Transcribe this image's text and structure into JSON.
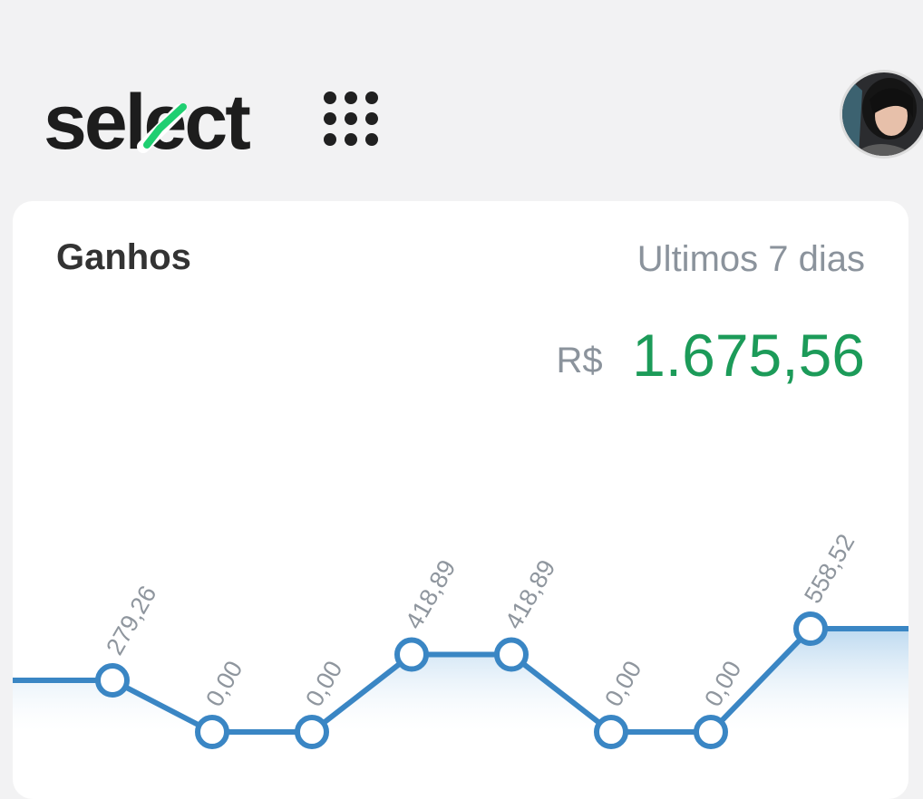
{
  "header": {
    "logo_text": "select",
    "logo_accent_color": "#1fcf71",
    "apps_icon": "apps-grid-icon",
    "avatar_icon": "user-avatar"
  },
  "card": {
    "title": "Ganhos",
    "period": "Ultimos 7 dias",
    "currency": "R$",
    "amount": "1.675,56",
    "amount_color": "#1c9b59"
  },
  "chart_data": {
    "type": "line",
    "title": "",
    "xlabel": "",
    "ylabel": "",
    "categories": [
      "",
      "",
      "",
      "",
      "",
      "",
      "",
      ""
    ],
    "values": [
      279.26,
      0.0,
      0.0,
      418.89,
      418.89,
      0.0,
      0.0,
      558.52
    ],
    "labels": [
      "279,26",
      "0,00",
      "0,00",
      "418,89",
      "418,89",
      "0,00",
      "0,00",
      "558,52"
    ],
    "ylim": [
      0,
      558.52
    ],
    "grid": false,
    "line_color": "#3a86c4",
    "fill": "area-gradient"
  }
}
